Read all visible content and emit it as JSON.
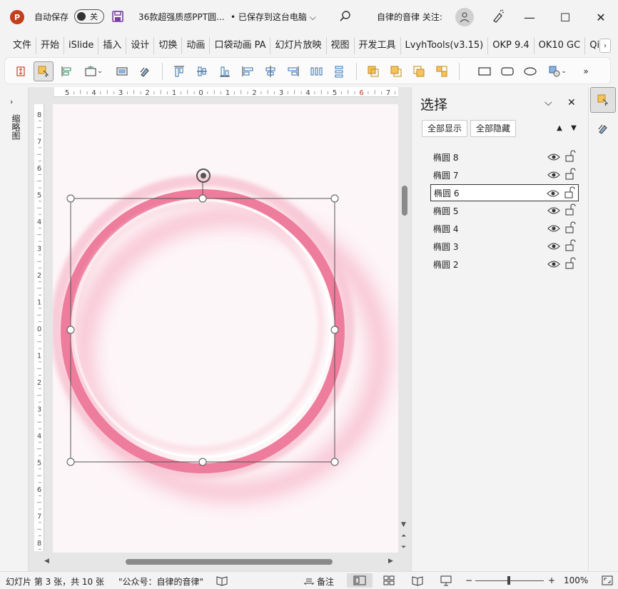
{
  "titlebar": {
    "app_logo": "P",
    "autosave_label": "自动保存",
    "toggle_state": "关",
    "doc_title": "36款超强质感PPT圆...",
    "save_status": "• 已保存到这台电脑",
    "follow_text": "自律的音律 关注:"
  },
  "menu": [
    "文件",
    "开始",
    "iSlide",
    "插入",
    "设计",
    "切换",
    "动画",
    "口袋动画 PA",
    "幻灯片放映",
    "视图",
    "开发工具",
    "LvyhTools(v3.15)",
    "OKP 9.4",
    "OK10 GC",
    "Qir"
  ],
  "left_pane": {
    "label": "缩略图"
  },
  "ruler": {
    "h_ticks": [
      "5",
      "4",
      "3",
      "2",
      "1",
      "0",
      "1",
      "2",
      "3",
      "4",
      "5",
      "6",
      "7"
    ],
    "v_ticks": [
      "8",
      "7",
      "6",
      "5",
      "4",
      "3",
      "2",
      "1",
      "0",
      "1",
      "2",
      "3",
      "4",
      "5",
      "6",
      "7",
      "8"
    ]
  },
  "selection_pane": {
    "title": "选择",
    "show_all": "全部显示",
    "hide_all": "全部隐藏",
    "layers": [
      "椭圆 8",
      "椭圆 7",
      "椭圆 6",
      "椭圆 5",
      "椭圆 4",
      "椭圆 3",
      "椭圆 2"
    ],
    "selected_layer": "椭圆 6"
  },
  "statusbar": {
    "slide_info": "幻灯片 第 3 张，共 10 张",
    "public_account": "\"公众号：自律的音律\"",
    "notes": "备注",
    "zoom": "100%"
  },
  "colors": {
    "ring_dark": "#ee7c9c",
    "ring_light": "#f8c8d5",
    "slide_bg": "#fdf6f8",
    "accent_orange": "#f0a830"
  }
}
